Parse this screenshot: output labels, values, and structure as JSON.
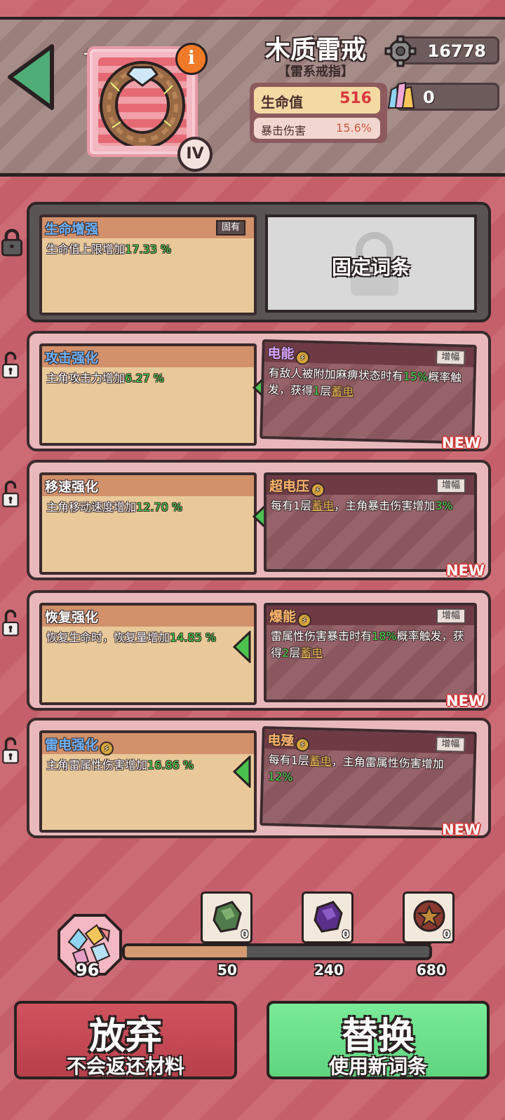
{
  "header": {
    "plus_level": "+1",
    "item_name": "木质雷戒",
    "item_type": "【雷系戒指】",
    "tier": "IV",
    "info_glyph": "i",
    "stat_main_label": "生命值",
    "stat_main_value": "516",
    "stat_sub_label": "暴击伤害",
    "stat_sub_value": "15.6%",
    "gear_currency": "16778",
    "crystal_currency": "0"
  },
  "rows": [
    {
      "current_name": "生命增强",
      "current_desc_prefix": "生命值上限增加",
      "current_value": "17.33 %",
      "current_tag": "固有",
      "fixed_label": "固定词条"
    },
    {
      "current_name": "攻击强化",
      "current_desc_prefix": "主角攻击力增加",
      "current_value": "6.27 %",
      "new_name": "电能",
      "new_tag": "增幅",
      "new_desc_a": "有敌人被附加麻痹状态时有",
      "new_value_a": "15%",
      "new_desc_b": "概率触发，获得",
      "new_value_b": "1",
      "new_desc_c": "层",
      "new_keyword": "蓄电",
      "new_desc_d": "",
      "new_badge": "NEW"
    },
    {
      "current_name": "移速强化",
      "current_desc_prefix": "主角移动速度增加",
      "current_value": "12.70 %",
      "new_name": "超电压",
      "new_tag": "增幅",
      "new_desc_a": "每有1层",
      "new_keyword": "蓄电",
      "new_desc_b": "，主角暴击伤害增加",
      "new_value_a": "3%",
      "new_badge": "NEW"
    },
    {
      "current_name": "恢复强化",
      "current_desc_prefix": "恢复生命时，恢复量增加",
      "current_value": "14.85 %",
      "new_name": "爆能",
      "new_tag": "增幅",
      "new_desc_a": "雷属性伤害暴击时有",
      "new_value_a": "18%",
      "new_desc_b": "概率触发，获得",
      "new_value_b": "2",
      "new_desc_c": "层",
      "new_keyword": "蓄电",
      "new_badge": "NEW"
    },
    {
      "current_name": "雷电强化",
      "current_desc_prefix": "主角雷属性伤害增加",
      "current_value": "16.86 %",
      "new_name": "电殛",
      "new_tag": "增幅",
      "new_desc_a": "每有1层",
      "new_keyword": "蓄电",
      "new_desc_b": "，主角雷属性伤害增加",
      "new_value_a": "12%",
      "new_badge": "NEW"
    }
  ],
  "materials": {
    "owned": "96",
    "progress_fraction": 0.4,
    "milestones": [
      {
        "threshold": "50",
        "count": "0",
        "icon": "green-gem-icon"
      },
      {
        "threshold": "240",
        "count": "0",
        "icon": "purple-gem-icon"
      },
      {
        "threshold": "680",
        "count": "0",
        "icon": "star-gem-icon"
      }
    ]
  },
  "buttons": {
    "abandon_main": "放弃",
    "abandon_sub": "不会返还材料",
    "replace_main": "替换",
    "replace_sub": "使用新词条"
  },
  "colors": {
    "accent_green": "#46d84a",
    "abandon_red": "#c8444f",
    "replace_green": "#6fe38e"
  }
}
